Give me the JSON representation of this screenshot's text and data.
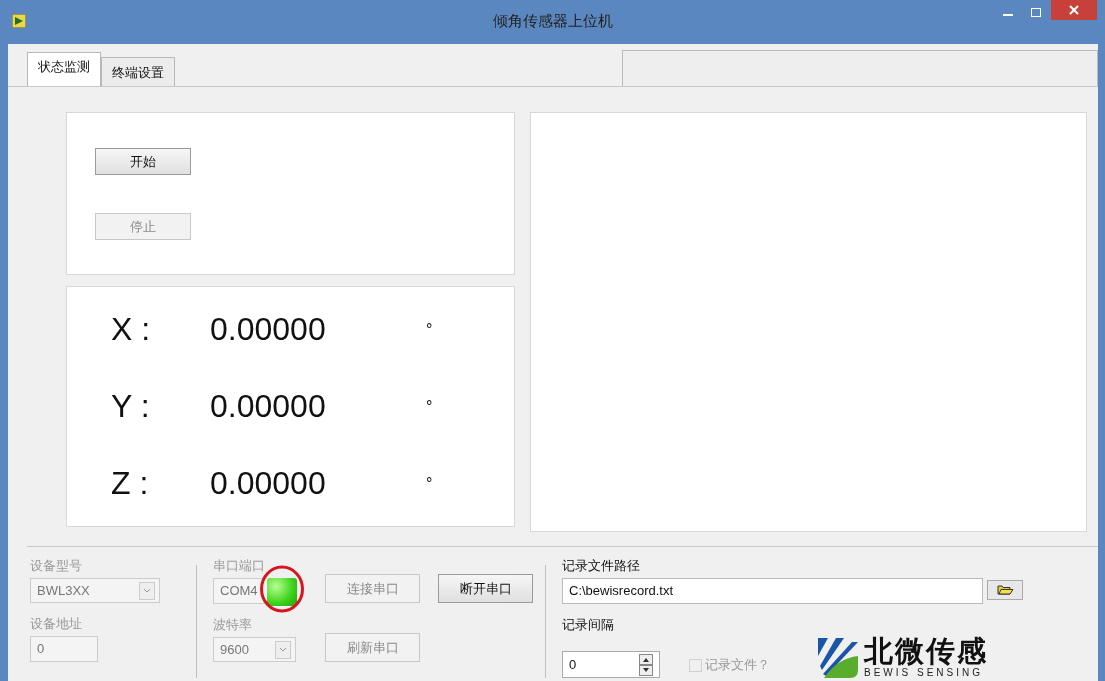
{
  "window": {
    "title": "倾角传感器上位机"
  },
  "tabs": [
    {
      "label": "状态监测",
      "selected": true
    },
    {
      "label": "终端设置",
      "selected": false
    }
  ],
  "controls": {
    "start": {
      "label": "开始",
      "disabled": false
    },
    "stop": {
      "label": "停止",
      "disabled": true
    }
  },
  "readings": [
    {
      "axis": "X :",
      "value": "0.00000",
      "unit": "°"
    },
    {
      "axis": "Y :",
      "value": "0.00000",
      "unit": "°"
    },
    {
      "axis": "Z :",
      "value": "0.00000",
      "unit": "°"
    }
  ],
  "device": {
    "model_label": "设备型号",
    "model": "BWL3XX",
    "model_disabled": true,
    "address_label": "设备地址",
    "address": "0",
    "address_disabled": true
  },
  "serial": {
    "port_label": "串口端口",
    "port": "COM4",
    "port_disabled": true,
    "led_on": true,
    "led_highlighted": true,
    "baud_label": "波特率",
    "baud": "9600",
    "baud_disabled": true,
    "connect": {
      "label": "连接串口",
      "disabled": true
    },
    "disconnect": {
      "label": "断开串口",
      "disabled": false
    },
    "refresh": {
      "label": "刷新串口",
      "disabled": true
    }
  },
  "record": {
    "path_label": "记录文件路径",
    "path": "C:\\bewisrecord.txt",
    "interval_label": "记录间隔",
    "interval": "0",
    "checkbox": {
      "label": "记录文件？",
      "checked": false,
      "disabled": true
    }
  },
  "logo": {
    "name": "北微传感",
    "tagline": "BEWIS SENSING"
  }
}
